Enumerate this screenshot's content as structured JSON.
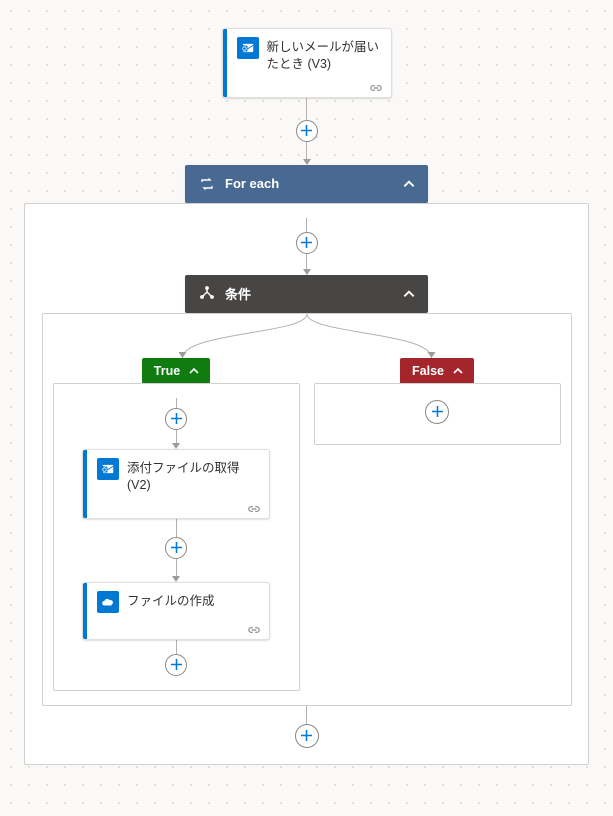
{
  "trigger": {
    "title": "新しいメールが届いたとき (V3)"
  },
  "foreach": {
    "label": "For each"
  },
  "condition": {
    "label": "条件",
    "true_label": "True",
    "false_label": "False"
  },
  "actions": {
    "get_attachment": {
      "title": "添付ファイルの取得 (V2)"
    },
    "create_file": {
      "title": "ファイルの作成"
    }
  }
}
